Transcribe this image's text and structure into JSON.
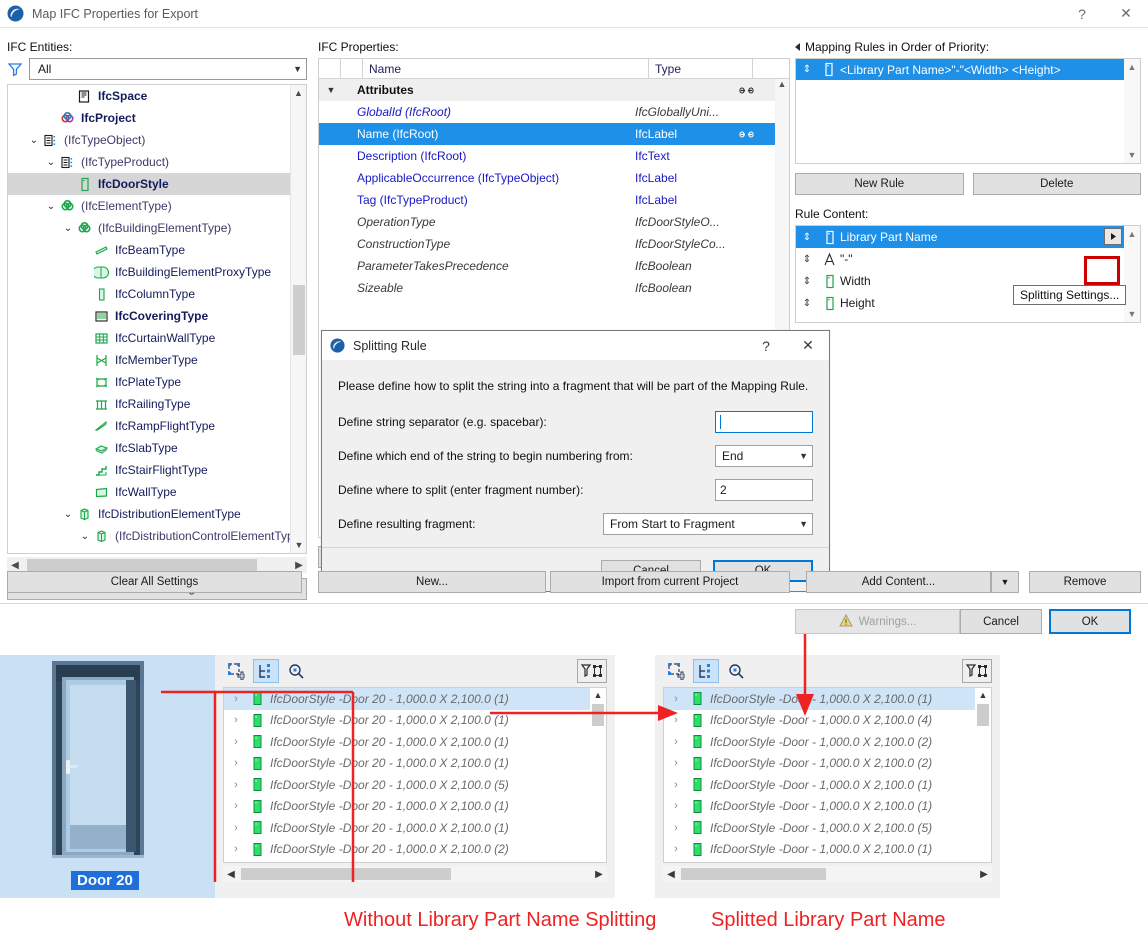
{
  "window": {
    "title": "Map IFC Properties for Export",
    "help_label": "?",
    "close_label": "✕"
  },
  "entities": {
    "label": "IFC Entities:",
    "filter_icon": "funnel-icon",
    "filter_value": "All",
    "tree": [
      {
        "indent": 3,
        "twisty": "",
        "icon": "ifcspace-icon",
        "label": "IfcSpace",
        "style": "bold",
        "selected": false
      },
      {
        "indent": 2,
        "twisty": "",
        "icon": "ifcproject-icon",
        "label": "IfcProject",
        "style": "bold",
        "selected": false
      },
      {
        "indent": 1,
        "twisty": "v",
        "icon": "typeobject-icon",
        "label": "(IfcTypeObject)",
        "style": "abstract",
        "selected": false
      },
      {
        "indent": 2,
        "twisty": "v",
        "icon": "typeobject-icon",
        "label": "(IfcTypeProduct)",
        "style": "abstract",
        "selected": false
      },
      {
        "indent": 3,
        "twisty": "",
        "icon": "door-icon",
        "label": "IfcDoorStyle",
        "style": "bold",
        "selected": true
      },
      {
        "indent": 2,
        "twisty": "v",
        "icon": "elementtype-icon",
        "label": "(IfcElementType)",
        "style": "abstract",
        "selected": false
      },
      {
        "indent": 3,
        "twisty": "v",
        "icon": "elementtype-icon",
        "label": "(IfcBuildingElementType)",
        "style": "abstract",
        "selected": false
      },
      {
        "indent": 4,
        "twisty": "",
        "icon": "beam-icon",
        "label": "IfcBeamType",
        "style": "normal",
        "selected": false
      },
      {
        "indent": 4,
        "twisty": "",
        "icon": "proxy-icon",
        "label": "IfcBuildingElementProxyType",
        "style": "normal",
        "selected": false
      },
      {
        "indent": 4,
        "twisty": "",
        "icon": "column-icon",
        "label": "IfcColumnType",
        "style": "normal",
        "selected": false
      },
      {
        "indent": 4,
        "twisty": "",
        "icon": "covering-icon",
        "label": "IfcCoveringType",
        "style": "bold",
        "selected": false
      },
      {
        "indent": 4,
        "twisty": "",
        "icon": "curtainwall-icon",
        "label": "IfcCurtainWallType",
        "style": "normal",
        "selected": false
      },
      {
        "indent": 4,
        "twisty": "",
        "icon": "member-icon",
        "label": "IfcMemberType",
        "style": "normal",
        "selected": false
      },
      {
        "indent": 4,
        "twisty": "",
        "icon": "plate-icon",
        "label": "IfcPlateType",
        "style": "normal",
        "selected": false
      },
      {
        "indent": 4,
        "twisty": "",
        "icon": "railing-icon",
        "label": "IfcRailingType",
        "style": "normal",
        "selected": false
      },
      {
        "indent": 4,
        "twisty": "",
        "icon": "rampflight-icon",
        "label": "IfcRampFlightType",
        "style": "normal",
        "selected": false
      },
      {
        "indent": 4,
        "twisty": "",
        "icon": "slab-icon",
        "label": "IfcSlabType",
        "style": "normal",
        "selected": false
      },
      {
        "indent": 4,
        "twisty": "",
        "icon": "stairflight-icon",
        "label": "IfcStairFlightType",
        "style": "normal",
        "selected": false
      },
      {
        "indent": 4,
        "twisty": "",
        "icon": "wall-icon",
        "label": "IfcWallType",
        "style": "normal",
        "selected": false
      },
      {
        "indent": 3,
        "twisty": "v",
        "icon": "distrib-icon",
        "label": "IfcDistributionElementType",
        "style": "normal",
        "selected": false
      },
      {
        "indent": 4,
        "twisty": "v",
        "icon": "distrib-icon",
        "label": "(IfcDistributionControlElementType)",
        "style": "abstract",
        "selected": false
      }
    ],
    "clear_button": "Clear All Settings"
  },
  "properties": {
    "label": "IFC Properties:",
    "columns": {
      "name": "Name",
      "type": "Type"
    },
    "rows": [
      {
        "name": "Attributes",
        "type": "",
        "kind": "group",
        "link": true,
        "selected": false
      },
      {
        "name": "GlobalId (IfcRoot)",
        "type": "IfcGloballyUni...",
        "kind": "italic-blue",
        "link": false,
        "selected": false
      },
      {
        "name": "Name (IfcRoot)",
        "type": "IfcLabel",
        "kind": "plain-blue",
        "link": true,
        "selected": true
      },
      {
        "name": "Description (IfcRoot)",
        "type": "IfcText",
        "kind": "plain-blue",
        "link": false,
        "selected": false
      },
      {
        "name": "ApplicableOccurrence (IfcTypeObject)",
        "type": "IfcLabel",
        "kind": "plain-blue",
        "link": false,
        "selected": false
      },
      {
        "name": "Tag (IfcTypeProduct)",
        "type": "IfcLabel",
        "kind": "plain-blue",
        "link": false,
        "selected": false
      },
      {
        "name": "OperationType",
        "type": "IfcDoorStyleO...",
        "kind": "italic-gray",
        "link": false,
        "selected": false
      },
      {
        "name": "ConstructionType",
        "type": "IfcDoorStyleCo...",
        "kind": "italic-gray",
        "link": false,
        "selected": false
      },
      {
        "name": "ParameterTakesPrecedence",
        "type": "IfcBoolean",
        "kind": "italic-gray",
        "link": false,
        "selected": false
      },
      {
        "name": "Sizeable",
        "type": "IfcBoolean",
        "kind": "italic-gray",
        "link": false,
        "selected": false
      }
    ],
    "new_button": "New...",
    "import_button": "Import from current Project"
  },
  "mapping": {
    "label": "Mapping Rules in Order of Priority:",
    "rules": [
      {
        "text": "<Library Part Name>\"-\"<Width> <Height>",
        "icon": "door-icon",
        "selected": true
      }
    ],
    "new_rule_button": "New Rule",
    "delete_button": "Delete",
    "rule_content_label": "Rule Content:",
    "rule_content": [
      {
        "text": "Library Part Name",
        "icon": "door-icon",
        "selected": true,
        "has_split_button": true
      },
      {
        "text": "\"-\"",
        "icon": "text-a-icon",
        "selected": false,
        "has_split_button": false
      },
      {
        "text": "Width",
        "icon": "door-icon",
        "selected": false,
        "has_split_button": false
      },
      {
        "text": "Height",
        "icon": "door-icon",
        "selected": false,
        "has_split_button": false
      }
    ],
    "tooltip": "Splitting Settings...",
    "add_content_button": "Add Content...",
    "remove_button": "Remove"
  },
  "footer": {
    "warnings_button": "Warnings...",
    "warnings_icon": "warning-triangle-icon",
    "cancel_button": "Cancel",
    "ok_button": "OK"
  },
  "splitting_dialog": {
    "title": "Splitting Rule",
    "help_label": "?",
    "close_label": "✕",
    "intro": "Please define how to split the string into a fragment that will be part of the Mapping Rule.",
    "fields": [
      {
        "label": "Define string separator (e.g. spacebar):",
        "kind": "input",
        "value": ""
      },
      {
        "label": "Define which end of the string to begin numbering from:",
        "kind": "select",
        "value": "End"
      },
      {
        "label": "Define where to split (enter fragment number):",
        "kind": "input",
        "value": "2"
      },
      {
        "label": "Define resulting fragment:",
        "kind": "select",
        "value": "From Start to Fragment"
      }
    ],
    "cancel_button": "Cancel",
    "ok_button": "OK"
  },
  "illustration": {
    "door_preview": {
      "label": "Door 20",
      "icon": "door-render"
    },
    "toolbars": {
      "add_icon": "add-selection-icon",
      "tree_icon": "tree-view-icon",
      "search_icon": "search-icon",
      "filter_icon": "filter-criteria-icon"
    },
    "left_panel": {
      "caption": "Without Library Part Name Splitting",
      "rows": [
        {
          "prefix": "IfcDoorStyle - ",
          "body": "Door 20 - 1,000.0 X 2,100.0 (1)",
          "selected": true
        },
        {
          "prefix": "IfcDoorStyle - ",
          "body": "Door 20 - 1,000.0 X 2,100.0 (1)",
          "selected": false
        },
        {
          "prefix": "IfcDoorStyle - ",
          "body": "Door 20 - 1,000.0 X 2,100.0 (1)",
          "selected": false
        },
        {
          "prefix": "IfcDoorStyle - ",
          "body": "Door 20 - 1,000.0 X 2,100.0 (1)",
          "selected": false
        },
        {
          "prefix": "IfcDoorStyle - ",
          "body": "Door 20 - 1,000.0 X 2,100.0 (5)",
          "selected": false
        },
        {
          "prefix": "IfcDoorStyle - ",
          "body": "Door 20 - 1,000.0 X 2,100.0 (1)",
          "selected": false
        },
        {
          "prefix": "IfcDoorStyle - ",
          "body": "Door 20 - 1,000.0 X 2,100.0 (1)",
          "selected": false
        },
        {
          "prefix": "IfcDoorStyle - ",
          "body": "Door 20 - 1,000.0 X 2,100.0 (2)",
          "selected": false
        }
      ]
    },
    "right_panel": {
      "caption": "Splitted Library Part Name",
      "rows": [
        {
          "prefix": "IfcDoorStyle - ",
          "body": "Door - 1,000.0 X 2,100.0 (1)",
          "selected": true
        },
        {
          "prefix": "IfcDoorStyle - ",
          "body": "Door - 1,000.0 X 2,100.0 (4)",
          "selected": false
        },
        {
          "prefix": "IfcDoorStyle - ",
          "body": "Door - 1,000.0 X 2,100.0 (2)",
          "selected": false
        },
        {
          "prefix": "IfcDoorStyle - ",
          "body": "Door - 1,000.0 X 2,100.0 (2)",
          "selected": false
        },
        {
          "prefix": "IfcDoorStyle - ",
          "body": "Door - 1,000.0 X 2,100.0 (1)",
          "selected": false
        },
        {
          "prefix": "IfcDoorStyle - ",
          "body": "Door - 1,000.0 X 2,100.0 (1)",
          "selected": false
        },
        {
          "prefix": "IfcDoorStyle - ",
          "body": "Door - 1,000.0 X 2,100.0 (5)",
          "selected": false
        },
        {
          "prefix": "IfcDoorStyle - ",
          "body": "Door - 1,000.0 X 2,100.0 (1)",
          "selected": false
        }
      ]
    }
  },
  "colors": {
    "selection_blue": "#1e90e8",
    "annotation_red": "#ee2222",
    "highlight_red": "#cc0000",
    "link_blue": "#1818c8"
  }
}
